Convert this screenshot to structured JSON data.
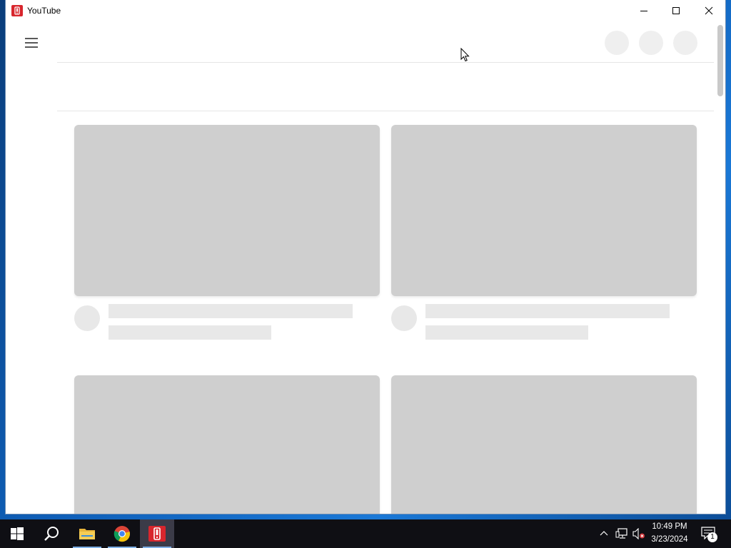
{
  "window": {
    "title": "YouTube",
    "app_icon": "youtube-app-icon",
    "controls": [
      "minimize-icon",
      "maximize-icon",
      "close-icon"
    ]
  },
  "header": {
    "menu_icon": "hamburger-menu-icon",
    "placeholder_buttons": 3
  },
  "feed": {
    "state": "loading-skeleton",
    "cards_visible": 4
  },
  "taskbar": {
    "items": [
      "start-icon",
      "search-icon",
      "file-explorer-icon",
      "chrome-icon",
      "youtube-app-icon"
    ],
    "clock": {
      "time": "10:49 PM",
      "date": "3/23/2024"
    },
    "notification_count": "1",
    "colors": {
      "background": "#0f0f14",
      "active": "#3b3b48",
      "accent": "#7fb0e6"
    }
  },
  "colors": {
    "skeleton_thumbnail": "#cfcfcf",
    "skeleton_text": "#e8e8e8",
    "app_brand": "#d8262d"
  }
}
